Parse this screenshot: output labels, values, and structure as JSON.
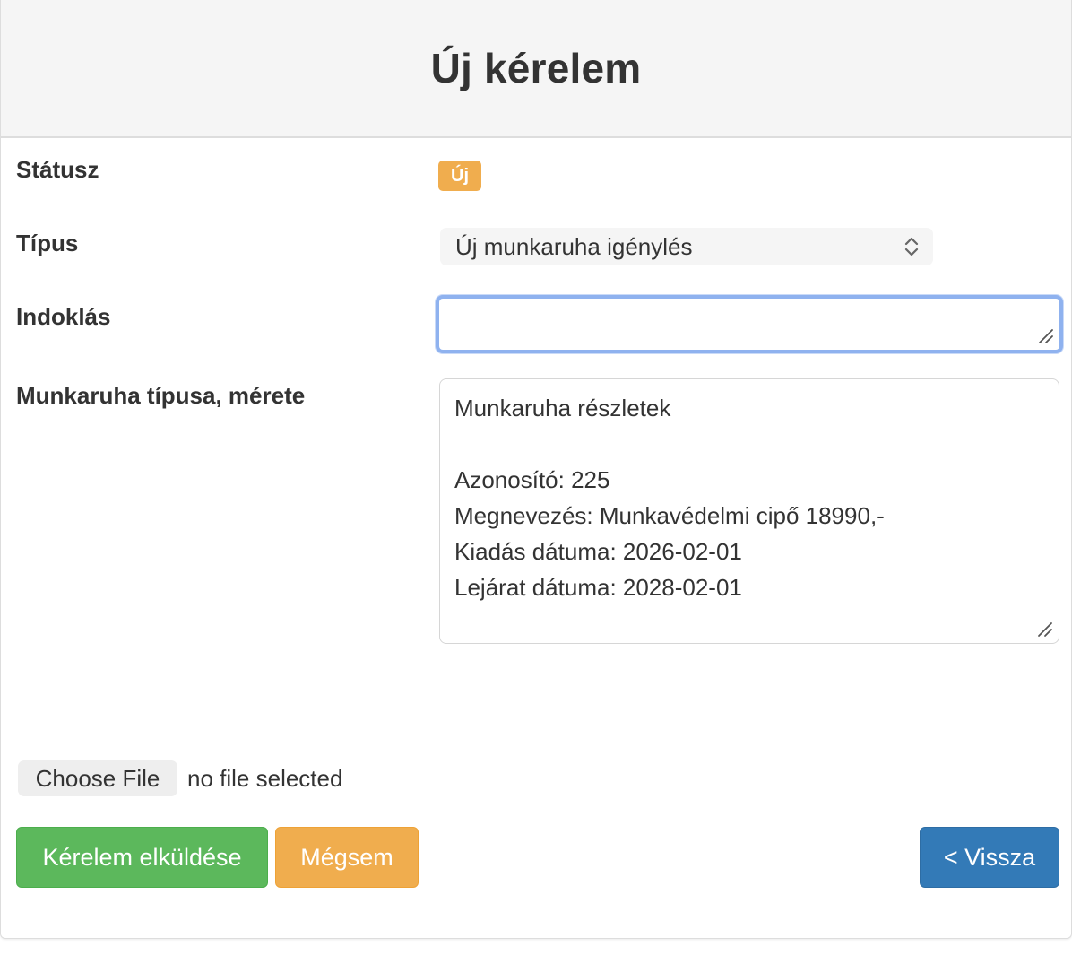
{
  "header": {
    "title": "Új kérelem"
  },
  "form": {
    "status": {
      "label": "Státusz",
      "badge": "Új",
      "badge_color": "#f0ad4e"
    },
    "type": {
      "label": "Típus",
      "selected": "Új munkaruha igénylés"
    },
    "justification": {
      "label": "Indoklás",
      "value": ""
    },
    "workwear": {
      "label": "Munkaruha típusa, mérete",
      "lines": [
        "Munkaruha részletek",
        "",
        "Azonosító: 225",
        "Megnevezés: Munkavédelmi cipő 18990,-",
        "Kiadás dátuma: 2026-02-01",
        "Lejárat dátuma: 2028-02-01"
      ]
    },
    "file": {
      "button_label": "Choose File",
      "status": "no file selected"
    }
  },
  "actions": {
    "submit_label": "Kérelem elküldése",
    "cancel_label": "Mégsem",
    "back_label": "< Vissza"
  },
  "colors": {
    "success": "#5cb85c",
    "warning": "#f0ad4e",
    "primary": "#337ab7",
    "focus": "#8fb2ef"
  }
}
